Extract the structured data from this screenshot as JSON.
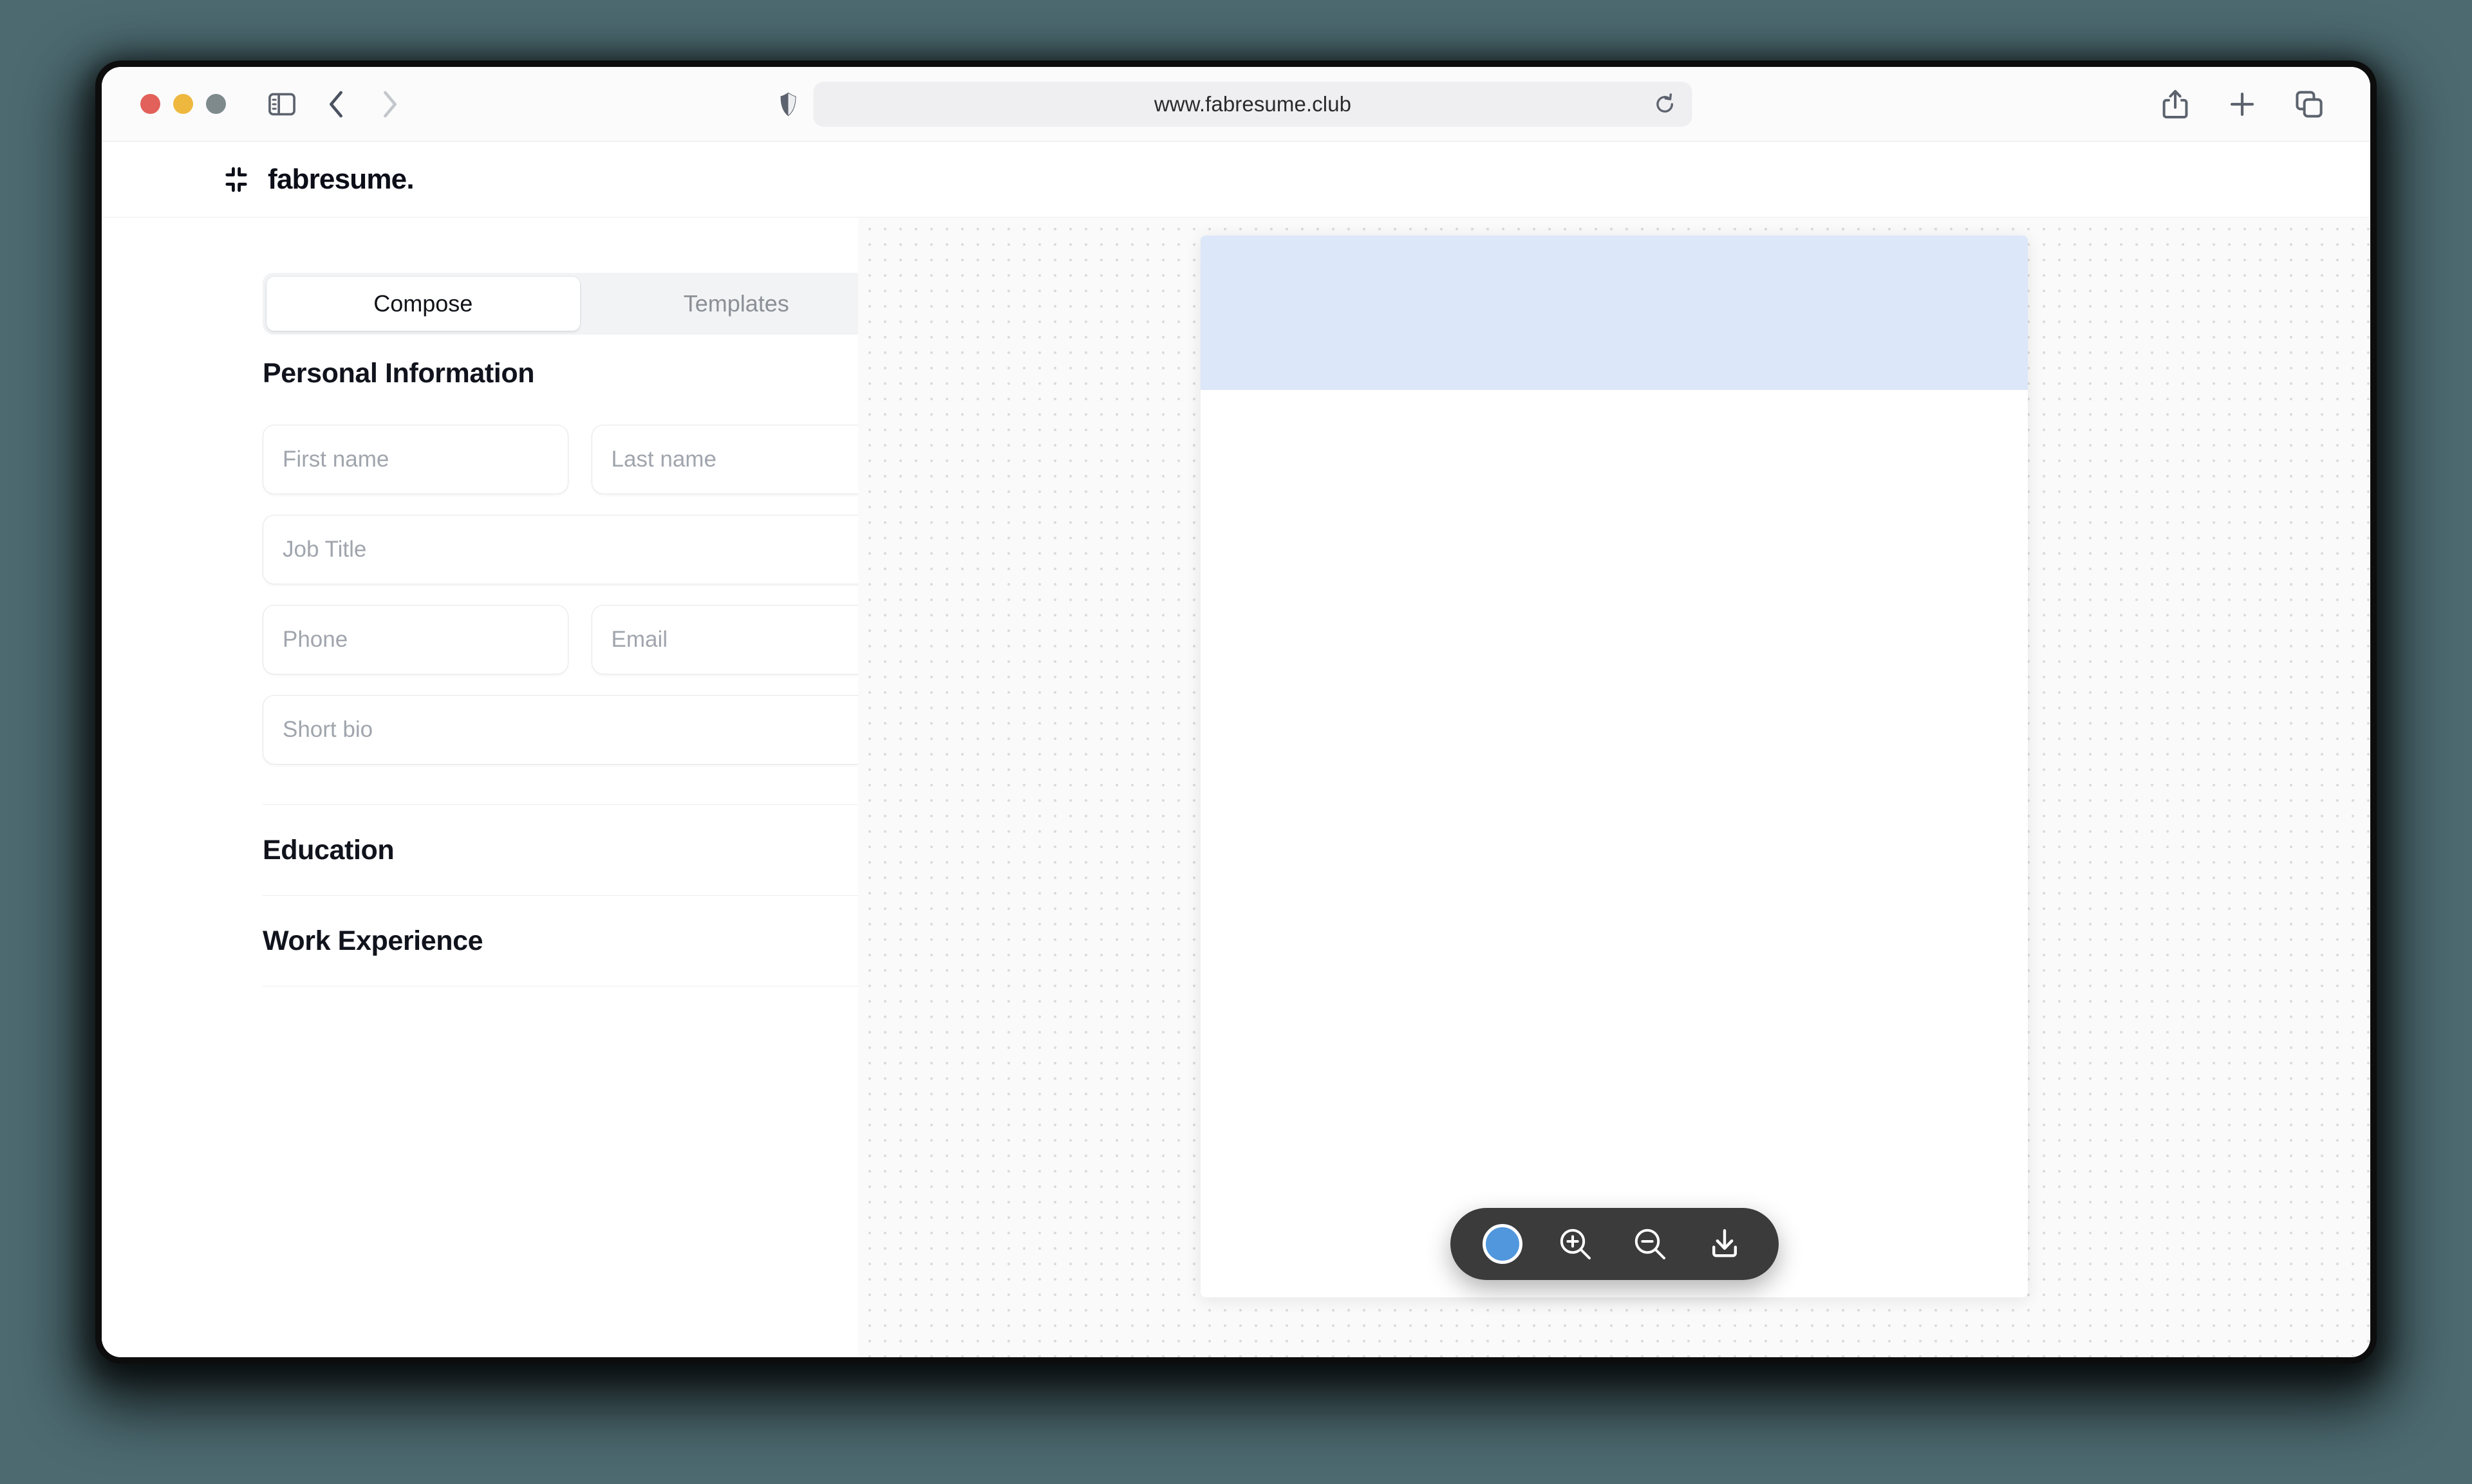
{
  "browser": {
    "url": "www.fabresume.club",
    "traffic_lights": [
      "close",
      "minimize",
      "zoom"
    ],
    "icons": {
      "sidebar_toggle": "sidebar-toggle-icon",
      "back": "back-chevron-icon",
      "forward": "forward-chevron-icon",
      "shield": "privacy-shield-icon",
      "reload": "reload-icon",
      "share": "share-icon",
      "new_tab": "plus-icon",
      "tab_overview": "tab-overview-icon"
    }
  },
  "app": {
    "brand_name": "fabresume.",
    "brand_mark": "collapse-corners-icon"
  },
  "tabs": [
    {
      "label": "Compose",
      "active": true
    },
    {
      "label": "Templates",
      "active": false
    }
  ],
  "personal_information": {
    "title": "Personal Information",
    "expanded": true,
    "chevron": "chevron-up-icon",
    "fields": [
      {
        "name": "first-name",
        "placeholder": "First name",
        "value": ""
      },
      {
        "name": "last-name",
        "placeholder": "Last name",
        "value": ""
      },
      {
        "name": "job-title",
        "placeholder": "Job Title",
        "value": ""
      },
      {
        "name": "phone",
        "placeholder": "Phone",
        "value": ""
      },
      {
        "name": "email",
        "placeholder": "Email",
        "value": ""
      },
      {
        "name": "short-bio",
        "placeholder": "Short bio",
        "value": ""
      }
    ]
  },
  "sections": [
    {
      "title": "Education",
      "expanded": false,
      "chevron": "chevron-down-icon"
    },
    {
      "title": "Work Experience",
      "expanded": false,
      "chevron": "chevron-down-icon"
    }
  ],
  "preview": {
    "banner_color": "#dce7f9",
    "page_color": "#ffffff"
  },
  "preview_toolbar": {
    "accent_color": "#5197dd",
    "background": "#3b3b3b",
    "buttons": [
      {
        "name": "color-swatch",
        "icon": "color-circle-icon"
      },
      {
        "name": "zoom-in",
        "icon": "magnifier-plus-icon"
      },
      {
        "name": "zoom-out",
        "icon": "magnifier-minus-icon"
      },
      {
        "name": "download",
        "icon": "download-icon"
      }
    ]
  },
  "colors": {
    "desktop_background": "#4c6a70",
    "accent": "#5197dd",
    "text_primary": "#10131c",
    "text_placeholder": "#a0a5ad"
  }
}
